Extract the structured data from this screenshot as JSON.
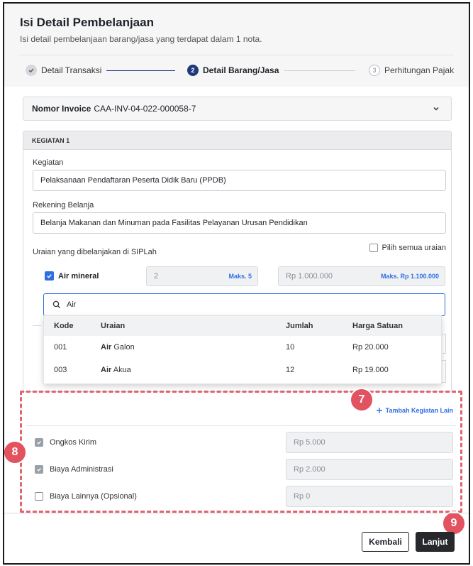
{
  "header": {
    "title": "Isi Detail Pembelanjaan",
    "subtitle": "Isi detail pembelanjaan barang/jasa yang terdapat dalam 1 nota."
  },
  "steps": [
    {
      "num": "✓",
      "label": "Detail Transaksi",
      "state": "done"
    },
    {
      "num": "2",
      "label": "Detail Barang/Jasa",
      "state": "active"
    },
    {
      "num": "3",
      "label": "Perhitungan Pajak",
      "state": "pending"
    }
  ],
  "invoice": {
    "label": "Nomor Invoice",
    "value": "CAA-INV-04-022-000058-7"
  },
  "kegiatan": {
    "heading": "KEGIATAN 1",
    "kegiatan_label": "Kegiatan",
    "kegiatan_value": "Pelaksanaan Pendaftaran Peserta Didik Baru (PPDB)",
    "rekening_label": "Rekening Belanja",
    "rekening_value": "Belanja Makanan dan Minuman pada Fasilitas Pelayanan Urusan Pendidikan",
    "uraian_label": "Uraian yang dibelanjakan di SIPLah",
    "pilih_semua": "Pilih semua uraian",
    "item": {
      "name": "Air mineral",
      "qty": "2",
      "qty_max": "Maks. 5",
      "price": "Rp 1.000.000",
      "price_max": "Maks. Rp 1.100.000"
    },
    "search_value": "Air"
  },
  "dropdown": {
    "headers": {
      "kode": "Kode",
      "uraian": "Uraian",
      "jumlah": "Jumlah",
      "harga": "Harga Satuan"
    },
    "rows": [
      {
        "kode": "001",
        "uraian_bold": "Air",
        "uraian_rest": " Galon",
        "jumlah": "10",
        "harga": "Rp 20.000"
      },
      {
        "kode": "003",
        "uraian_bold": "Air",
        "uraian_rest": " Akua",
        "jumlah": "12",
        "harga": "Rp 19.000"
      }
    ]
  },
  "tambah_label": "Tambah Kegiatan Lain",
  "fees": [
    {
      "label": "Ongkos Kirim",
      "value": "Rp 5.000",
      "checked": true
    },
    {
      "label": "Biaya Administrasi",
      "value": "Rp 2.000",
      "checked": true
    },
    {
      "label": "Biaya Lainnya (Opsional)",
      "value": "Rp 0",
      "checked": false
    }
  ],
  "badges": {
    "b7": "7",
    "b8": "8",
    "b9": "9"
  },
  "footer": {
    "kembali": "Kembali",
    "lanjut": "Lanjut"
  },
  "colors": {
    "accent": "#2f6fe4",
    "primary_dark": "#1e3a7b",
    "annotation": "#e2525f"
  }
}
